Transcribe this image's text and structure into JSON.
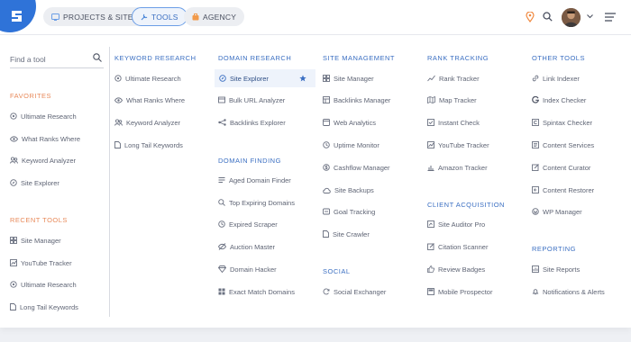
{
  "header": {
    "tabs": [
      {
        "label": "PROJECTS & SITES"
      },
      {
        "label": "TOOLS"
      },
      {
        "label": "AGENCY"
      }
    ]
  },
  "search": {
    "placeholder": "Find a tool"
  },
  "sidebar": {
    "favorites_title": "FAVORITES",
    "favorites": [
      "Ultimate Research",
      "What Ranks Where",
      "Keyword Analyzer",
      "Site Explorer"
    ],
    "recent_title": "RECENT TOOLS",
    "recent": [
      "Site Manager",
      "YouTube Tracker",
      "Ultimate Research",
      "Long Tail Keywords"
    ]
  },
  "columns": {
    "keyword_research": {
      "title": "KEYWORD RESEARCH",
      "items": [
        "Ultimate Research",
        "What Ranks Where",
        "Keyword Analyzer",
        "Long Tail Keywords"
      ]
    },
    "domain_research": {
      "title": "DOMAIN RESEARCH",
      "items": [
        "Site Explorer",
        "Bulk URL Analyzer",
        "Backlinks Explorer"
      ]
    },
    "domain_finding": {
      "title": "DOMAIN FINDING",
      "items": [
        "Aged Domain Finder",
        "Top Expiring Domains",
        "Expired Scraper",
        "Auction Master",
        "Domain Hacker",
        "Exact Match Domains"
      ]
    },
    "site_management": {
      "title": "SITE MANAGEMENT",
      "items": [
        "Site Manager",
        "Backlinks Manager",
        "Web Analytics",
        "Uptime Monitor",
        "Cashflow Manager",
        "Site Backups",
        "Goal Tracking",
        "Site Crawler"
      ]
    },
    "social": {
      "title": "SOCIAL",
      "items": [
        "Social Exchanger"
      ]
    },
    "rank_tracking": {
      "title": "RANK TRACKING",
      "items": [
        "Rank Tracker",
        "Map Tracker",
        "Instant Check",
        "YouTube Tracker",
        "Amazon Tracker"
      ]
    },
    "client_acquisition": {
      "title": "CLIENT ACQUISITION",
      "items": [
        "Site Auditor Pro",
        "Citation Scanner",
        "Review Badges",
        "Mobile Prospector"
      ]
    },
    "other_tools": {
      "title": "OTHER TOOLS",
      "items": [
        "Link Indexer",
        "Index Checker",
        "Spintax Checker",
        "Content Services",
        "Content Curator",
        "Content Restorer",
        "WP Manager"
      ]
    },
    "reporting": {
      "title": "REPORTING",
      "items": [
        "Site Reports",
        "Notifications & Alerts"
      ]
    }
  },
  "colors": {
    "accent": "#2f73d8",
    "section_blue": "#3b6fc2",
    "section_orange": "#e88a5a",
    "selected_bg": "#eef3fb"
  }
}
